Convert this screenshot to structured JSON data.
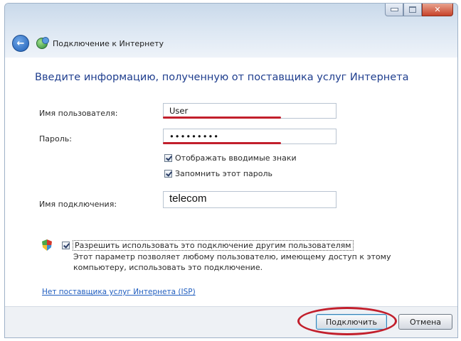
{
  "window": {
    "title": "Подключение к Интернету",
    "caption": {
      "minimize": "minimize-icon",
      "maximize": "maximize-icon",
      "close": "close-icon"
    }
  },
  "form": {
    "heading": "Введите информацию, полученную от поставщика услуг Интернета",
    "username_label": "Имя пользователя:",
    "username_value": "User",
    "password_label": "Пароль:",
    "password_value": "•••••••••",
    "show_chars_label": "Отображать вводимые знаки",
    "show_chars_checked": true,
    "remember_label": "Запомнить этот пароль",
    "remember_checked": true,
    "connection_name_label": "Имя подключения:",
    "connection_name_value": "telecom",
    "allow_others_label": "Разрешить использовать это подключение другим пользователям",
    "allow_others_checked": true,
    "allow_others_desc": "Этот параметр позволяет любому пользователю, имеющему доступ к этому компьютеру, использовать это подключение.",
    "isp_link": "Нет поставщика услуг Интернета (ISP)"
  },
  "buttons": {
    "connect": "Подключить",
    "cancel": "Отмена"
  },
  "annotation_color": "#c21f2c"
}
